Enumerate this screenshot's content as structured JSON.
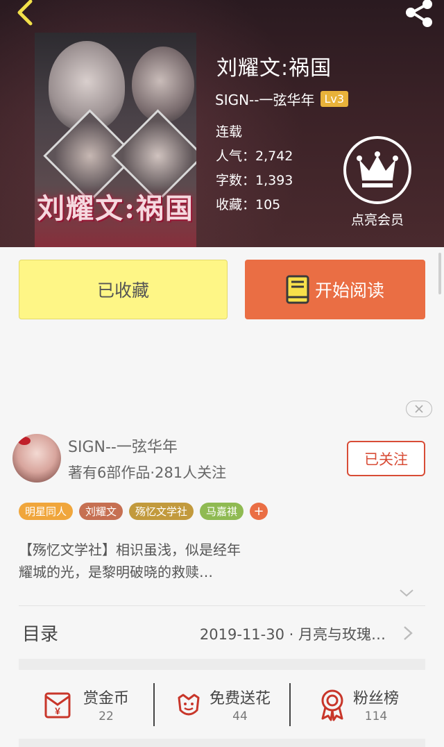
{
  "book": {
    "title": "刘耀文:祸国",
    "cover_title_art": "刘耀文:祸国",
    "author": "SIGN--一弦华年",
    "level": "Lv3",
    "status": "连载",
    "popularity": "人气：2,742",
    "word_count": "字数：1,393",
    "favorites": "收藏：105"
  },
  "vip": {
    "label": "点亮会员"
  },
  "buttons": {
    "collected": "已收藏",
    "start_reading": "开始阅读"
  },
  "author_card": {
    "name": "SIGN--一弦华年",
    "meta": "著有6部作品·281人关注",
    "follow": "已关注"
  },
  "tags": [
    {
      "label": "明星同人",
      "color": "#f0a63c"
    },
    {
      "label": "刘耀文",
      "color": "#c67052"
    },
    {
      "label": "殇忆文学社",
      "color": "#c29a3d"
    },
    {
      "label": "马嘉祺",
      "color": "#8fba52"
    }
  ],
  "tag_add": "+",
  "description": {
    "line1": "【殇忆文学社】相识虽浅，似是经年",
    "line2": "耀城的光，是黎明破晓的救赎…"
  },
  "toc": {
    "label": "目录",
    "latest": "2019-11-30 · 月亮与玫瑰…"
  },
  "actions": [
    {
      "label": "赏金币",
      "count": "22",
      "icon": "coin-envelope-icon"
    },
    {
      "label": "免费送花",
      "count": "44",
      "icon": "flower-icon"
    },
    {
      "label": "粉丝榜",
      "count": "114",
      "icon": "award-ribbon-icon"
    }
  ],
  "colors": {
    "accent_orange": "#ea6e44",
    "collected_yellow": "#fef686",
    "follow_red": "#d84c36",
    "icon_red": "#c8362a",
    "level_gold": "#e8b23a",
    "header_bg": "#3b2227"
  }
}
